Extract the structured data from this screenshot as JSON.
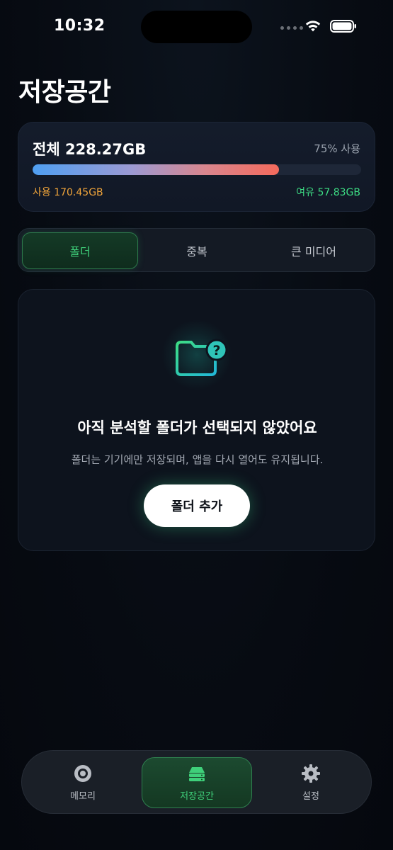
{
  "status_bar": {
    "time": "10:32"
  },
  "page": {
    "title": "저장공간"
  },
  "storage": {
    "total_label": "전체 228.27GB",
    "percent_label": "75% 사용",
    "usage_fraction": 0.75,
    "used_label": "사용 170.45GB",
    "free_label": "여유 57.83GB",
    "colors": {
      "used": "#f0a43a",
      "free": "#3ddc84",
      "bar_start": "#4f9ff2",
      "bar_end": "#f46a5c"
    }
  },
  "segments": {
    "items": [
      {
        "label": "폴더",
        "active": true
      },
      {
        "label": "중복",
        "active": false
      },
      {
        "label": "큰 미디어",
        "active": false
      }
    ],
    "accent": "#3fd07a"
  },
  "empty_state": {
    "icon": "folder-question-icon",
    "title": "아직 분석할 폴더가 선택되지 않았어요",
    "description": "폴더는 기기에만 저장되며, 앱을 다시 열어도 유지됩니다.",
    "button_label": "폴더 추가"
  },
  "tab_bar": {
    "items": [
      {
        "label": "메모리",
        "icon": "memory-disc-icon",
        "active": false
      },
      {
        "label": "저장공간",
        "icon": "storage-drive-icon",
        "active": true
      },
      {
        "label": "설정",
        "icon": "gear-icon",
        "active": false
      }
    ]
  }
}
